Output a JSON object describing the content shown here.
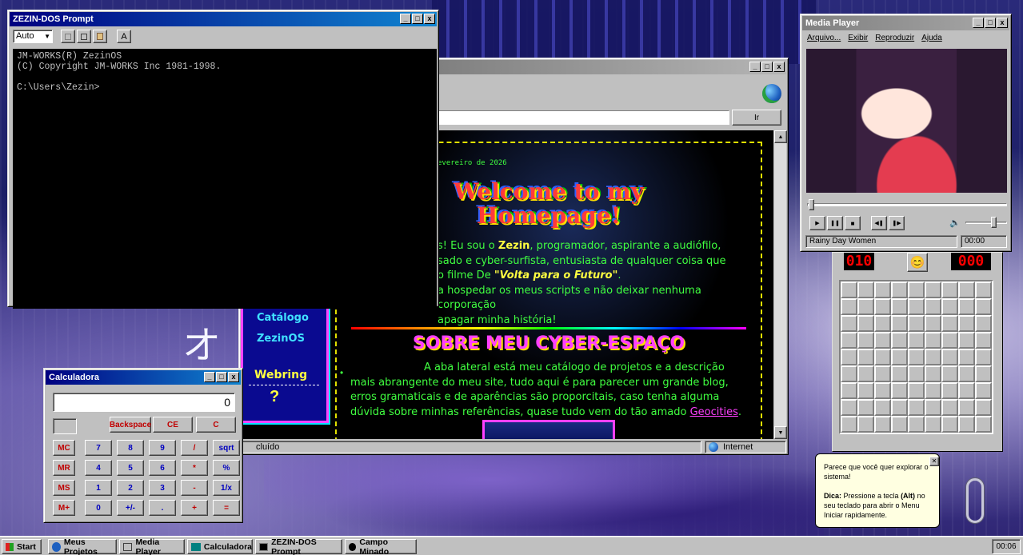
{
  "cmd": {
    "title": "ZEZIN-DOS Prompt",
    "font_select": "Auto",
    "toolbar_font_label": "A",
    "lines": [
      "JM-WORKS(R) ZezinOS",
      "(C) Copyright JM-WORKS Inc 1981-1998.",
      "",
      "C:\\Users\\Zezin>"
    ]
  },
  "browser": {
    "go_label": "Ir",
    "date": "evereiro de 2026",
    "welcome": "Welcome to my Homepage!",
    "intro_lines": [
      "s! Eu sou o ",
      "Zezin",
      ", programador, aspirante a audiófilo,",
      "sado e cyber-surfista, entusiasta de qualquer coisa que",
      "o filme De ",
      "\"Volta para o Futuro\"",
      ".",
      "a hospedar os meus scripts e não deixar nenhuma corporação",
      "apagar minha história!"
    ],
    "section_title": "SOBRE MEU CYBER-ESPAÇO",
    "about_text": "A aba lateral está meu catálogo de projetos e a descrição mais abrangente do meu site, tudo aqui é para parecer um grande blog, erros gramaticais e de aparências são proporcitais, caso tenha alguma dúvida sobre minhas referências, quase tudo vem do tão amado ",
    "about_link": "Geocities",
    "about_end": ".",
    "sidebar": [
      "Catálogo",
      "ZezinOS",
      "Webring"
    ],
    "status_left": "cluído",
    "status_zone": "Internet"
  },
  "media": {
    "title": "Media Player",
    "menu": [
      "Arquivo...",
      "Exibir",
      "Reproduzir",
      "Ajuda"
    ],
    "track": "Rainy Day Women",
    "time": "00:00",
    "progress": 0.0,
    "volume": 0.7
  },
  "mines": {
    "counter": "010",
    "timer": "000",
    "face": "😊"
  },
  "calc": {
    "title": "Calculadora",
    "display": "0",
    "top": [
      "Backspace",
      "CE",
      "C"
    ],
    "rows": [
      [
        "MC",
        "7",
        "8",
        "9",
        "/",
        "sqrt"
      ],
      [
        "MR",
        "4",
        "5",
        "6",
        "*",
        "%"
      ],
      [
        "MS",
        "1",
        "2",
        "3",
        "-",
        "1/x"
      ],
      [
        "M+",
        "0",
        "+/-",
        ".",
        "+",
        "="
      ]
    ]
  },
  "tip": {
    "line1": "Parece que você quer explorar o sistema!",
    "bold": "Dica:",
    "line2": " Pressione a tecla ",
    "key": "(Alt)",
    "line3": " no seu teclado para abrir o Menu Iniciar rapidamente.",
    "close": "✕"
  },
  "taskbar": {
    "start": "Start",
    "tasks": [
      "Meus Projetos",
      "Media Player",
      "Calculadora",
      "ZEZIN-DOS Prompt",
      "Campo Minado"
    ],
    "clock": "00:06"
  }
}
